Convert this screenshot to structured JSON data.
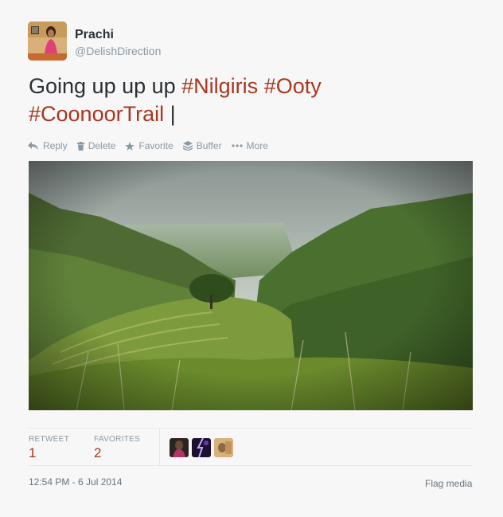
{
  "user": {
    "name": "Prachi",
    "handle": "@DelishDirection"
  },
  "tweet": {
    "text_plain": "Going up up up ",
    "hashtags": [
      "#Nilgiris",
      "#Ooty",
      "#CoonoorTrail"
    ],
    "cursor": "|"
  },
  "actions": [
    {
      "label": "Reply",
      "icon": "reply-icon"
    },
    {
      "label": "Delete",
      "icon": "trash-icon"
    },
    {
      "label": "Favorite",
      "icon": "star-icon"
    },
    {
      "label": "Buffer",
      "icon": "buffer-icon"
    },
    {
      "label": "More",
      "icon": "more-dots-icon"
    }
  ],
  "stats": {
    "retweet_label": "RETWEET",
    "retweet_count": "1",
    "favorites_label": "FAVORITES",
    "favorites_count": "2"
  },
  "footer": {
    "timestamp": "12:54 PM - 6 Jul 2014",
    "flag": "Flag media"
  },
  "colors": {
    "hashtag": "#a8371f",
    "muted": "#8899a6"
  }
}
